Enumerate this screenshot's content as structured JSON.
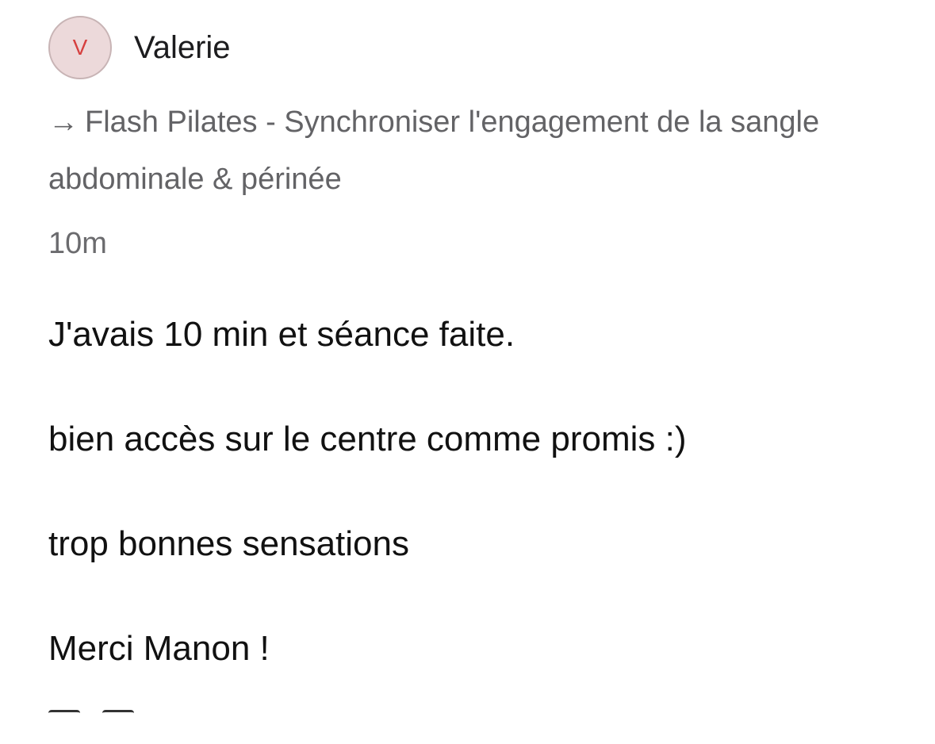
{
  "author": {
    "avatar_initial": "V",
    "name": "Valerie",
    "avatar_bg": "#ecd9da",
    "avatar_text_color": "#d6403f"
  },
  "program": {
    "arrow": "→",
    "title": "Flash Pilates - Synchroniser l'engagement de la sangle abdominale & périnée"
  },
  "duration": "10m",
  "message": {
    "lines": [
      "J'avais 10 min et séance faite.",
      "bien accès sur le centre comme promis :)",
      "trop bonnes sensations",
      "Merci Manon !"
    ]
  },
  "actions": {
    "icons": [
      "comment-icon",
      "like-icon"
    ]
  }
}
